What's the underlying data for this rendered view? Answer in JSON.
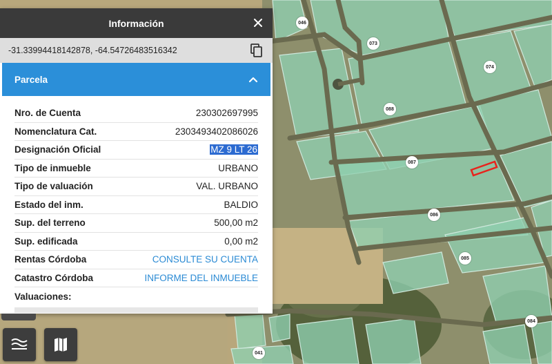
{
  "panel": {
    "title": "Información",
    "coordinates": "-31.33994418142878, -64.54726483516342",
    "section_title": "Parcela",
    "properties": [
      {
        "key": "Nro. de Cuenta",
        "value": "230302697995",
        "kind": "text"
      },
      {
        "key": "Nomenclatura Cat.",
        "value": "2303493402086026",
        "kind": "text"
      },
      {
        "key": "Designación Oficial",
        "value": "MZ 9 LT 26",
        "kind": "selected"
      },
      {
        "key": "Tipo de inmueble",
        "value": "URBANO",
        "kind": "text"
      },
      {
        "key": "Tipo de valuación",
        "value": "VAL. URBANO",
        "kind": "text"
      },
      {
        "key": "Estado del inm.",
        "value": "BALDIO",
        "kind": "text"
      },
      {
        "key": "Sup. del terreno",
        "value": "500,00 m2",
        "kind": "text"
      },
      {
        "key": "Sup. edificada",
        "value": "0,00 m2",
        "kind": "text"
      },
      {
        "key": "Rentas Córdoba",
        "value": "CONSULTE SU CUENTA",
        "kind": "link"
      },
      {
        "key": "Catastro Córdoba",
        "value": "INFORME DEL INMUEBLE",
        "kind": "link"
      },
      {
        "key": "Valuaciones:",
        "value": "",
        "kind": "text"
      }
    ]
  },
  "icons": {
    "close": "close-icon",
    "copy": "copy-icon",
    "collapse": "chevron-up-icon",
    "layers": "layers-icon",
    "basemap": "map-icon"
  },
  "map": {
    "lot_labels": [
      "046",
      "073",
      "074",
      "088",
      "087",
      "086",
      "085",
      "084",
      "041"
    ]
  },
  "colors": {
    "header": "#3a3a3a",
    "section": "#2b8fd9",
    "link": "#2a8ad4",
    "parcel_fill": "#8fcfb0",
    "highlight": "#e8231c"
  }
}
